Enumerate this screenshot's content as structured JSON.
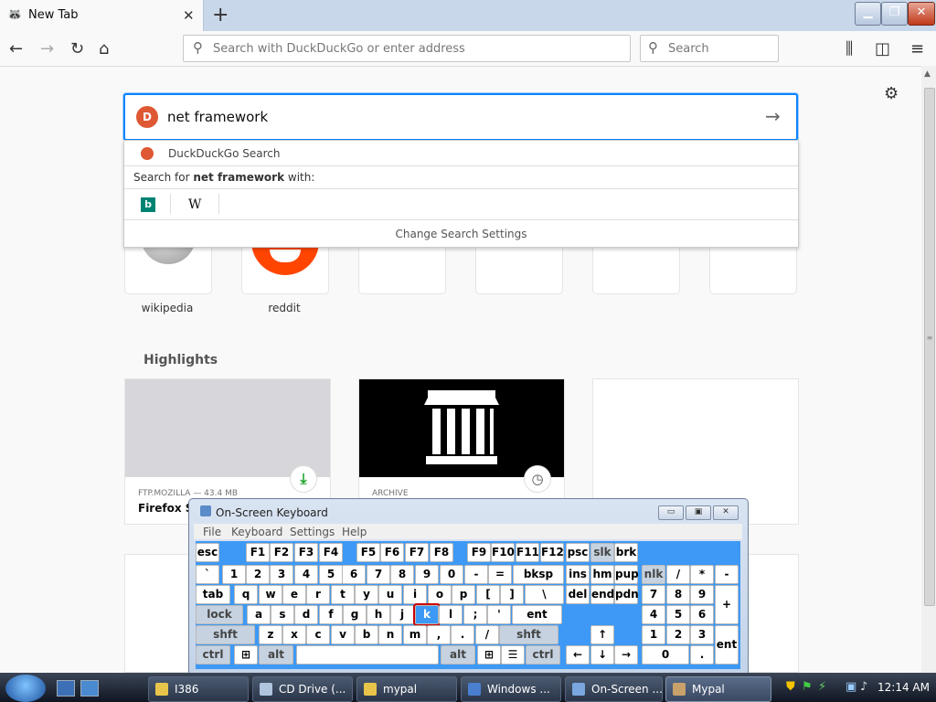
{
  "browser": {
    "tab_title": "New Tab",
    "tab_close": "✕",
    "new_tab": "+",
    "url_placeholder": "Search with DuckDuckGo or enter address",
    "search_placeholder": "Search"
  },
  "search_panel": {
    "query": "net framework",
    "engine_label": "DuckDuckGo Search",
    "search_for_prefix": "Search for ",
    "search_for_query": "net framework",
    "search_for_suffix": " with:",
    "bing_letter": "b",
    "wiki_letter": "W",
    "change_settings": "Change Search Settings"
  },
  "top_sites": [
    {
      "label": "wikipedia"
    },
    {
      "label": "reddit"
    }
  ],
  "highlights": {
    "heading": "Highlights",
    "cards": [
      {
        "source": "FTP.MOZILLA — 43.4 MB",
        "title": "Firefox Se"
      },
      {
        "source": "ARCHIVE",
        "title": ""
      }
    ]
  },
  "osk": {
    "title": "On-Screen Keyboard",
    "menu": [
      "File",
      "Keyboard",
      "Settings",
      "Help"
    ],
    "win_buttons": [
      "▭",
      "▣",
      "✕"
    ],
    "keys": [
      {
        "t": "esc"
      },
      {
        "t": "F1"
      },
      {
        "t": "F2"
      },
      {
        "t": "F3"
      },
      {
        "t": "F4"
      },
      {
        "t": "F5"
      },
      {
        "t": "F6"
      },
      {
        "t": "F7"
      },
      {
        "t": "F8"
      },
      {
        "t": "F9"
      },
      {
        "t": "F10"
      },
      {
        "t": "F11"
      },
      {
        "t": "F12"
      },
      {
        "t": "psc"
      },
      {
        "t": "slk",
        "dim": true
      },
      {
        "t": "brk"
      },
      {
        "t": "`"
      },
      {
        "t": "1"
      },
      {
        "t": "2"
      },
      {
        "t": "3"
      },
      {
        "t": "4"
      },
      {
        "t": "5"
      },
      {
        "t": "6"
      },
      {
        "t": "7"
      },
      {
        "t": "8"
      },
      {
        "t": "9"
      },
      {
        "t": "0"
      },
      {
        "t": "-"
      },
      {
        "t": "="
      },
      {
        "t": "bksp"
      },
      {
        "t": "ins"
      },
      {
        "t": "hm"
      },
      {
        "t": "pup"
      },
      {
        "t": "nlk",
        "dim": true
      },
      {
        "t": "/"
      },
      {
        "t": "*"
      },
      {
        "t": "-"
      },
      {
        "t": "tab"
      },
      {
        "t": "q"
      },
      {
        "t": "w"
      },
      {
        "t": "e"
      },
      {
        "t": "r"
      },
      {
        "t": "t"
      },
      {
        "t": "y"
      },
      {
        "t": "u"
      },
      {
        "t": "i"
      },
      {
        "t": "o"
      },
      {
        "t": "p"
      },
      {
        "t": "["
      },
      {
        "t": "]"
      },
      {
        "t": "\\"
      },
      {
        "t": "del"
      },
      {
        "t": "end"
      },
      {
        "t": "pdn"
      },
      {
        "t": "7"
      },
      {
        "t": "8"
      },
      {
        "t": "9"
      },
      {
        "t": "+"
      },
      {
        "t": "lock",
        "dim": true
      },
      {
        "t": "a"
      },
      {
        "t": "s"
      },
      {
        "t": "d"
      },
      {
        "t": "f"
      },
      {
        "t": "g"
      },
      {
        "t": "h"
      },
      {
        "t": "j"
      },
      {
        "t": "k",
        "sel": true
      },
      {
        "t": "l"
      },
      {
        "t": ";"
      },
      {
        "t": "'"
      },
      {
        "t": "ent"
      },
      {
        "t": "4"
      },
      {
        "t": "5"
      },
      {
        "t": "6"
      },
      {
        "t": "shft",
        "dim": true
      },
      {
        "t": "z"
      },
      {
        "t": "x"
      },
      {
        "t": "c"
      },
      {
        "t": "v"
      },
      {
        "t": "b"
      },
      {
        "t": "n"
      },
      {
        "t": "m"
      },
      {
        "t": ","
      },
      {
        "t": "."
      },
      {
        "t": "/"
      },
      {
        "t": "shft",
        "dim": true
      },
      {
        "t": "↑"
      },
      {
        "t": "1"
      },
      {
        "t": "2"
      },
      {
        "t": "3"
      },
      {
        "t": "ent"
      },
      {
        "t": "ctrl",
        "dim": true
      },
      {
        "t": "⊞"
      },
      {
        "t": "alt",
        "dim": true
      },
      {
        "t": ""
      },
      {
        "t": "alt",
        "dim": true
      },
      {
        "t": "⊞"
      },
      {
        "t": "☰"
      },
      {
        "t": "ctrl",
        "dim": true
      },
      {
        "t": "←"
      },
      {
        "t": "↓"
      },
      {
        "t": "→"
      },
      {
        "t": "0"
      },
      {
        "t": "."
      }
    ]
  },
  "taskbar": {
    "items": [
      {
        "label": "I386",
        "color": "#e8c54a"
      },
      {
        "label": "CD Drive (...",
        "color": "#b0c4de"
      },
      {
        "label": "mypal",
        "color": "#e8c54a"
      },
      {
        "label": "Windows ...",
        "color": "#4a7fd0"
      },
      {
        "label": "On-Screen ...",
        "color": "#7aa7e0"
      },
      {
        "label": "Mypal",
        "color": "#c8a26a",
        "active": true
      }
    ],
    "clock": "12:14 AM"
  }
}
